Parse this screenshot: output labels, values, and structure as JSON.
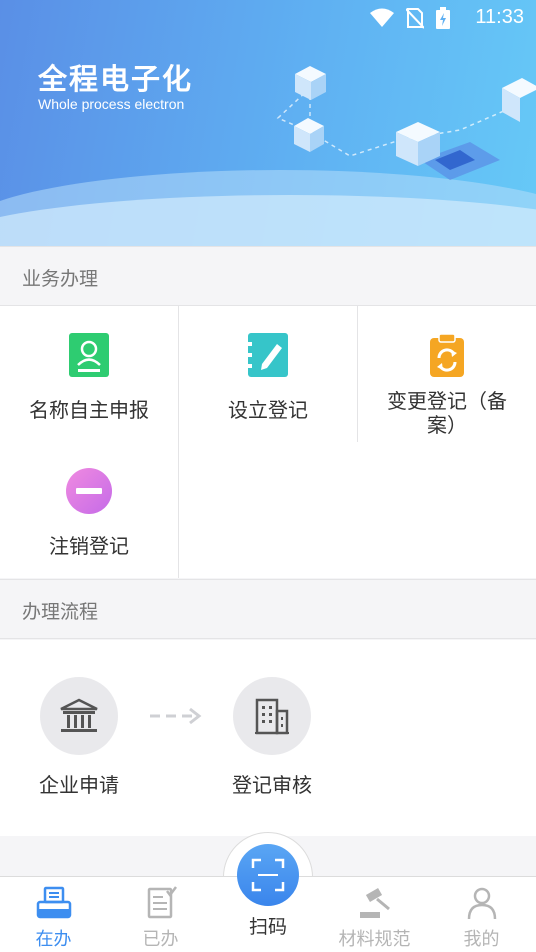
{
  "status_bar": {
    "time": "11:33"
  },
  "banner": {
    "title": "全程电子化",
    "subtitle": "Whole process electron"
  },
  "business": {
    "header": "业务办理",
    "items": [
      {
        "label": "名称自主申报",
        "icon": "contact-book-icon",
        "color": "#2ecc71"
      },
      {
        "label": "设立登记",
        "icon": "notepad-pen-icon",
        "color": "#36c5c9"
      },
      {
        "label": "变更登记（备案）",
        "icon": "clipboard-refresh-icon",
        "color": "#f5a623"
      },
      {
        "label": "注销登记",
        "icon": "minus-circle-icon",
        "color": "#e67ad8"
      }
    ]
  },
  "process": {
    "header": "办理流程",
    "steps": [
      {
        "label": "企业申请",
        "icon": "bank-building-icon"
      },
      {
        "label": "登记审核",
        "icon": "office-building-icon"
      }
    ]
  },
  "tabbar": {
    "tabs": [
      {
        "label": "在办",
        "icon": "printer-tray-icon",
        "active": true
      },
      {
        "label": "已办",
        "icon": "document-check-icon",
        "active": false
      },
      {
        "label": "扫码",
        "icon": "scan-icon",
        "active": false
      },
      {
        "label": "材料规范",
        "icon": "gavel-icon",
        "active": false
      },
      {
        "label": "我的",
        "icon": "user-icon",
        "active": false
      }
    ]
  }
}
